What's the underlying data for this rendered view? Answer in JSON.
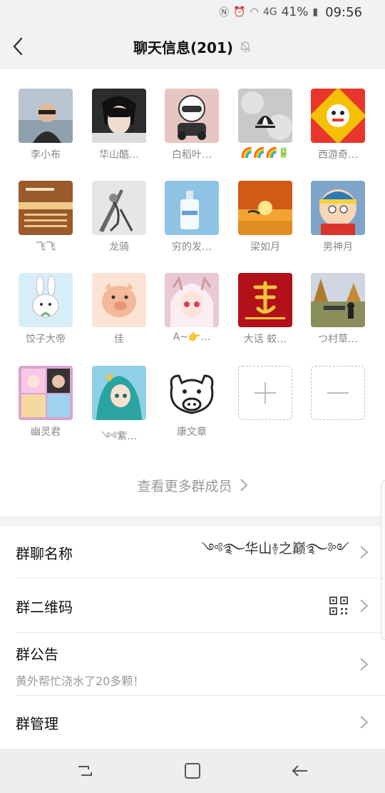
{
  "status_bar": {
    "battery": "41%",
    "time": "09:56",
    "network": "4G"
  },
  "header": {
    "title": "聊天信息(201)"
  },
  "members": [
    {
      "name": "李小布",
      "avatar": "person-photo",
      "color": "#b9c6d2"
    },
    {
      "name": "华山酷…",
      "avatar": "anime-boy",
      "color": "#2c2c2c"
    },
    {
      "name": "白稻叶…",
      "avatar": "cartoon-biker",
      "color": "#e7c6c2"
    },
    {
      "name": "🌈🌈🌈🔋",
      "avatar": "adidas-logo",
      "color": "#c9c9c9"
    },
    {
      "name": "西游奇…",
      "avatar": "lion-dance",
      "color": "#e8362d"
    },
    {
      "name": "飞飞",
      "avatar": "text-poster",
      "color": "#9a5a2c"
    },
    {
      "name": "龙骑",
      "avatar": "sketch-warrior",
      "color": "#e6e6e6"
    },
    {
      "name": "穷的发…",
      "avatar": "perfume-bottle",
      "color": "#8ec3e6"
    },
    {
      "name": "梁如月",
      "avatar": "sunset-sea",
      "color": "#e07a1f"
    },
    {
      "name": "男神月",
      "avatar": "cartoon-kid",
      "color": "#7ea4c9"
    },
    {
      "name": "饺子大帝",
      "avatar": "white-rabbit",
      "color": "#d7eef9"
    },
    {
      "name": "佳",
      "avatar": "pink-pig",
      "color": "#fbe3d6"
    },
    {
      "name": "A~👉…",
      "avatar": "anime-girl",
      "color": "#e9c9d6"
    },
    {
      "name": "大话 蛟…",
      "avatar": "red-calligraphy",
      "color": "#b2111a"
    },
    {
      "name": "つ村草…",
      "avatar": "park-photo",
      "color": "#8a8f5c"
    },
    {
      "name": "幽灵君",
      "avatar": "collage-photo",
      "color": "#d8a3cf"
    },
    {
      "name": "༺紫…",
      "avatar": "fairy-girl",
      "color": "#2aa4a0"
    },
    {
      "name": "康文章",
      "avatar": "pig-outline",
      "color": "#ffffff"
    }
  ],
  "more_members_label": "查看更多群成员",
  "settings": {
    "group_name_label": "群聊名称",
    "group_name_value": "༺࿐华山࿈之巅࿐༻",
    "qr_label": "群二维码",
    "notice_label": "群公告",
    "notice_text": "黄外帮忙浇水了20多颗！",
    "manage_label": "群管理"
  },
  "colors": {
    "accent_bg": "#f2f2f2",
    "divider": "#e8e8e8",
    "muted_text": "#999999"
  }
}
